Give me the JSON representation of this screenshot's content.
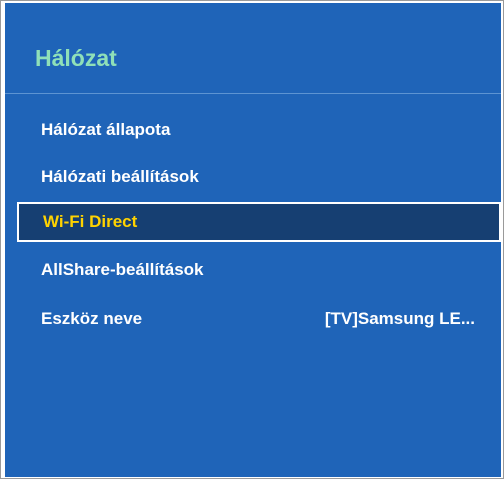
{
  "panel": {
    "title": "Hálózat",
    "colors": {
      "background": "#1f64b8",
      "title": "#8fe0b8",
      "text": "#ffffff",
      "selected_text": "#ffd300",
      "selected_background": "#163f72"
    }
  },
  "menu": {
    "items": [
      {
        "label": "Hálózat állapota",
        "value": "",
        "selected": false
      },
      {
        "label": "Hálózati beállítások",
        "value": "",
        "selected": false
      },
      {
        "label": "Wi-Fi Direct",
        "value": "",
        "selected": true
      },
      {
        "label": "AllShare-beállítások",
        "value": "",
        "selected": false
      },
      {
        "label": "Eszköz neve",
        "value": "[TV]Samsung LE...",
        "selected": false
      }
    ]
  }
}
